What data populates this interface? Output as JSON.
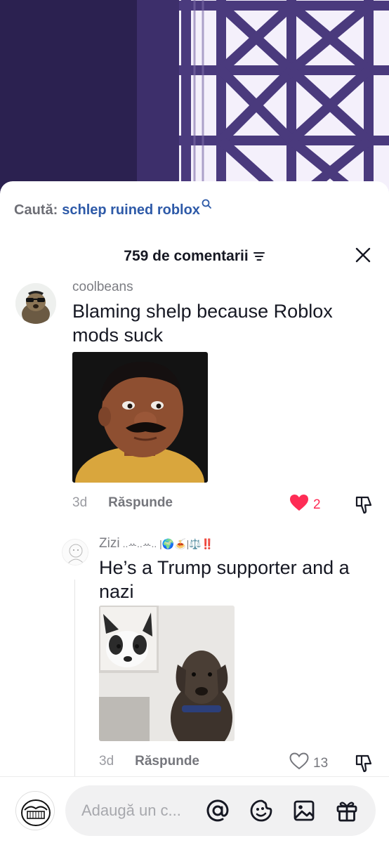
{
  "search": {
    "prefix": "Caută:",
    "query": "schlep ruined roblox",
    "icon": "search-icon"
  },
  "header": {
    "count_label": "759 de comentarii",
    "sort_icon": "sort-icon",
    "close_icon": "close-icon"
  },
  "comments": [
    {
      "user": "coolbeans",
      "text": "Blaming shelp because Roblox mods suck",
      "age": "3d",
      "reply_label": "Răspunde",
      "likes": "2",
      "liked": true,
      "image": "cartoon-man-portrait"
    },
    {
      "user": "Zizi",
      "user_decor": "..ꕀ..ꕀ.. |🌍🍝|⚖️‼️",
      "text": "He’s a Trump supporter and a nazi",
      "age": "3d",
      "reply_label": "Răspunde",
      "likes": "13",
      "liked": false,
      "image": "dog-meme"
    }
  ],
  "composer": {
    "placeholder": "Adaugă un c...",
    "icons": [
      "mention-icon",
      "emoji-icon",
      "image-icon",
      "gift-icon"
    ]
  },
  "colors": {
    "like_red": "#fe2c55",
    "link_blue": "#2e5aa8",
    "muted": "#7c7d83"
  }
}
